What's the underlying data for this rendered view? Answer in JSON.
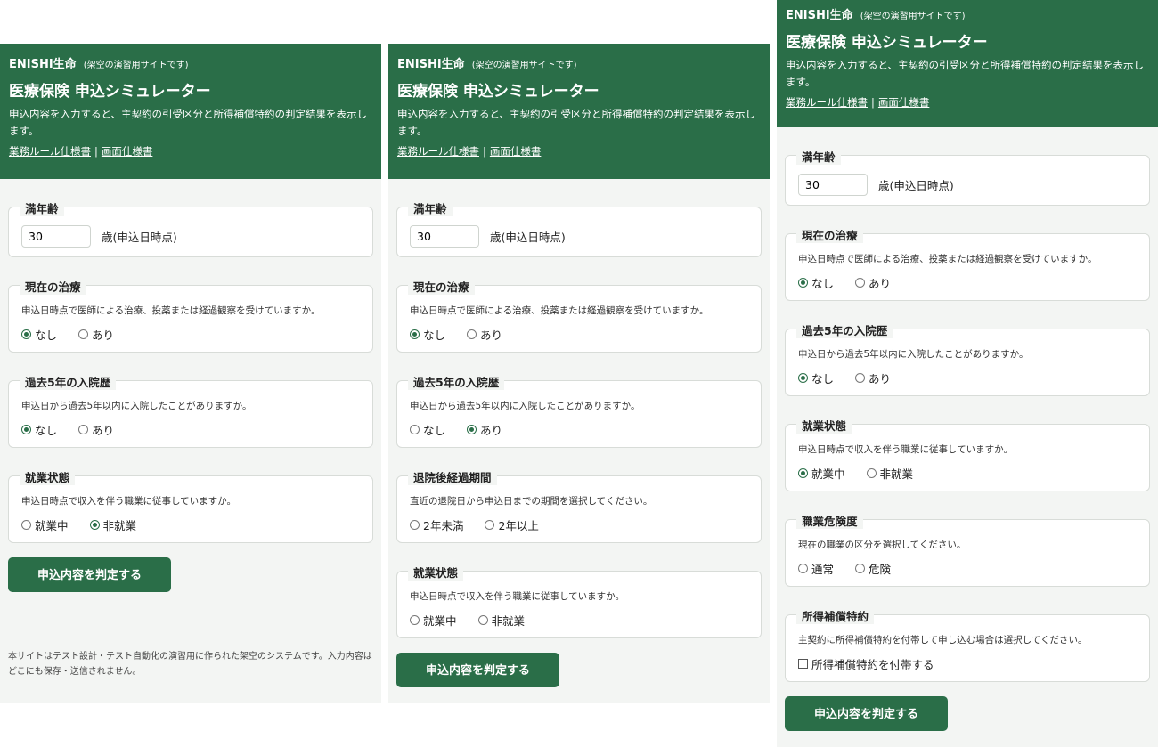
{
  "header": {
    "brand": "ENISHI生命",
    "brand_note": "(架空の演習用サイトです)",
    "title": "医療保険 申込シミュレーター",
    "desc": "申込内容を入力すると、主契約の引受区分と所得補償特約の判定結果を表示します。",
    "link_rules": "業務ルール仕様書",
    "link_sep": "|",
    "link_screen": "画面仕様書"
  },
  "age": {
    "legend": "満年齢",
    "value": "30",
    "unit": "歳(申込日時点)"
  },
  "treatment": {
    "legend": "現在の治療",
    "question": "申込日時点で医師による治療、投薬または経過観察を受けていますか。",
    "opt_no": "なし",
    "opt_yes": "あり"
  },
  "hospital": {
    "legend": "過去5年の入院歴",
    "question": "申込日から過去5年以内に入院したことがありますか。",
    "opt_no": "なし",
    "opt_yes": "あり"
  },
  "discharge": {
    "legend": "退院後経過期間",
    "question": "直近の退院日から申込日までの期間を選択してください。",
    "opt_lt": "2年未満",
    "opt_ge": "2年以上"
  },
  "employment": {
    "legend": "就業状態",
    "question": "申込日時点で収入を伴う職業に従事していますか。",
    "opt_emp": "就業中",
    "opt_unemp": "非就業"
  },
  "risk": {
    "legend": "職業危険度",
    "question": "現在の職業の区分を選択してください。",
    "opt_normal": "通常",
    "opt_danger": "危険"
  },
  "rider": {
    "legend": "所得補償特約",
    "question": "主契約に所得補償特約を付帯して申し込む場合は選択してください。",
    "check_label": "所得補償特約を付帯する"
  },
  "submit_label": "申込内容を判定する",
  "footer": "本サイトはテスト設計・テスト自動化の演習用に作られた架空のシステムです。入力内容はどこにも保存・送信されません。"
}
